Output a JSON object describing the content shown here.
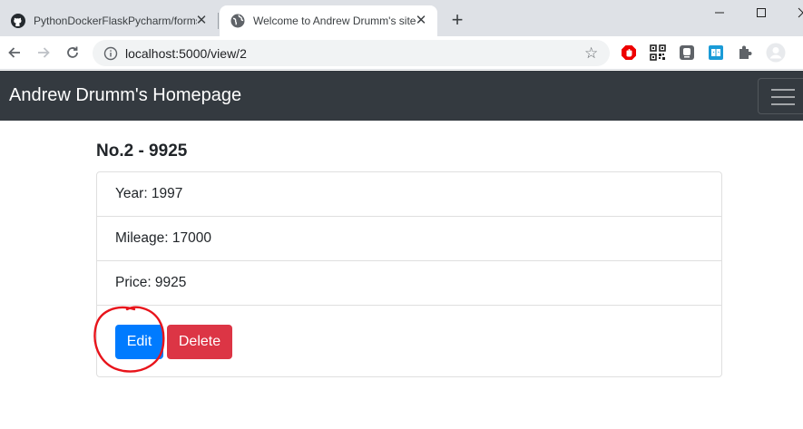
{
  "browser": {
    "tabs": [
      {
        "title": "PythonDockerFlaskPycharm/forms",
        "favicon": "github-icon"
      },
      {
        "title": "Welcome to Andrew Drumm's site",
        "favicon": "globe-icon"
      }
    ],
    "new_tab_label": "+",
    "url": "localhost:5000/view/2",
    "accent": "#dee1e6"
  },
  "navbar": {
    "brand": "Andrew Drumm's Homepage",
    "background": "#343a40"
  },
  "car": {
    "heading": "No.2 - 9925",
    "details": [
      {
        "label": "Year: 1997"
      },
      {
        "label": "Mileage: 17000"
      },
      {
        "label": "Price: 9925"
      }
    ],
    "actions": {
      "edit_label": "Edit",
      "delete_label": "Delete"
    }
  },
  "colors": {
    "edit": "#007bff",
    "delete": "#dc3545",
    "annotation": "#e8141b"
  }
}
